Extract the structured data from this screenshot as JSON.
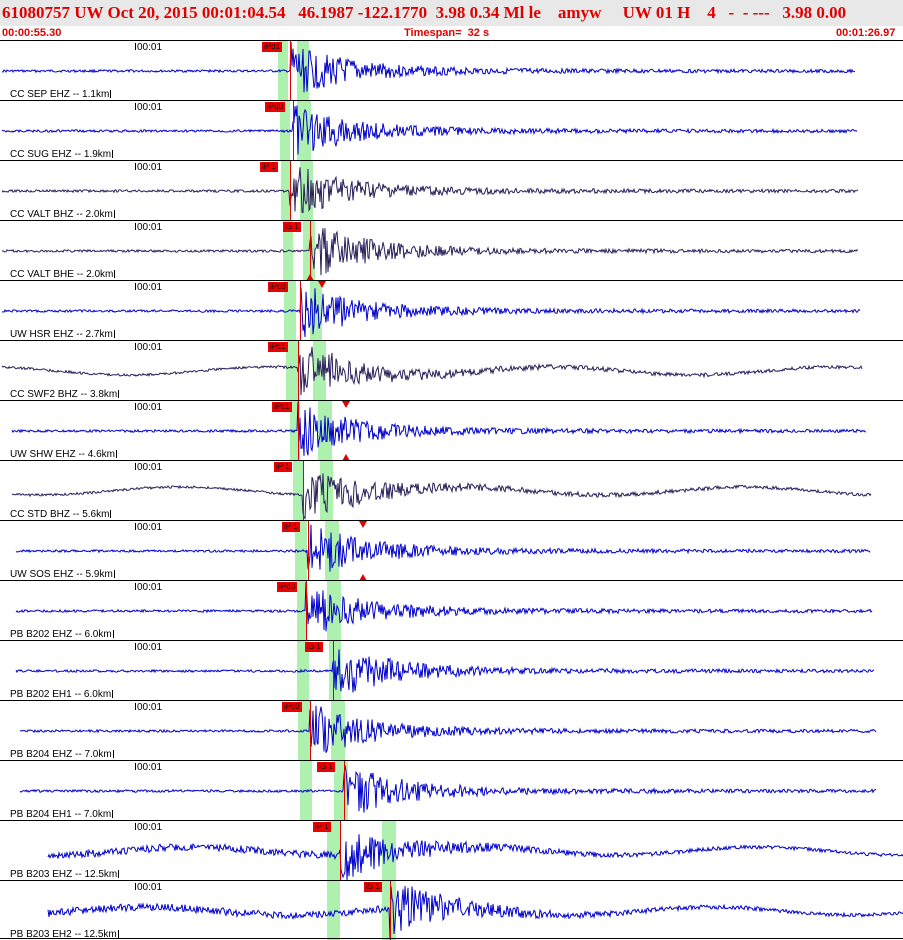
{
  "header": {
    "title": "61080757 UW Oct 20, 2015 00:01:04.54   46.1987 -122.1770  3.98 0.34 Ml le    amyw     UW 01 H    4   -  - ---   3.98 0.00",
    "start_time": "00:00:55.30",
    "timespan": "Timespan=  32 s",
    "end_time": "00:01:26.97"
  },
  "time_tick_label": "00:01",
  "colors": {
    "header_bg": "#e8e8e8",
    "pick": "#ee0000",
    "window": "#aef0ae",
    "trace_blue": "#0000cc",
    "trace_dark": "#2a1f5a"
  },
  "channels": [
    {
      "label": "CC SEP EHZ -- 1.1km",
      "picks": [
        "iPd1"
      ],
      "color": "blue"
    },
    {
      "label": "CC SUG EHZ -- 1.9km",
      "picks": [
        "iPd0"
      ],
      "color": "blue"
    },
    {
      "label": "CC VALT BHZ -- 2.0km",
      "picks": [
        "iP 1"
      ],
      "color": "dark"
    },
    {
      "label": "CC VALT BHE -- 2.0km",
      "picks": [
        "iS 1"
      ],
      "color": "dark"
    },
    {
      "label": "UW HSR EHZ -- 2.7km",
      "picks": [
        "iPc0"
      ],
      "color": "blue"
    },
    {
      "label": "CC SWF2 BHZ -- 3.8km",
      "picks": [
        "iPc1"
      ],
      "color": "dark"
    },
    {
      "label": "UW SHW EHZ -- 4.6km",
      "picks": [
        "iPc1"
      ],
      "color": "blue"
    },
    {
      "label": "CC STD BHZ -- 5.6km",
      "picks": [
        "iP 1"
      ],
      "color": "dark"
    },
    {
      "label": "UW SOS EHZ -- 5.9km",
      "picks": [
        "iP 1"
      ],
      "color": "blue"
    },
    {
      "label": "PB B202 EHZ -- 6.0km",
      "picks": [
        "iPd0"
      ],
      "color": "blue"
    },
    {
      "label": "PB B202 EH1 -- 6.0km",
      "picks": [
        "iS 1"
      ],
      "color": "blue"
    },
    {
      "label": "PB B204 EHZ -- 7.0km",
      "picks": [
        "iPc0"
      ],
      "color": "blue"
    },
    {
      "label": "PB B204 EH1 -- 7.0km",
      "picks": [
        "iS 1"
      ],
      "color": "blue"
    },
    {
      "label": "PB B203 EHZ -- 12.5km",
      "picks": [
        "iP 1"
      ],
      "color": "blue"
    },
    {
      "label": "PB B203 EH2 -- 12.5km",
      "picks": [
        "iS 1"
      ],
      "color": "blue"
    }
  ]
}
